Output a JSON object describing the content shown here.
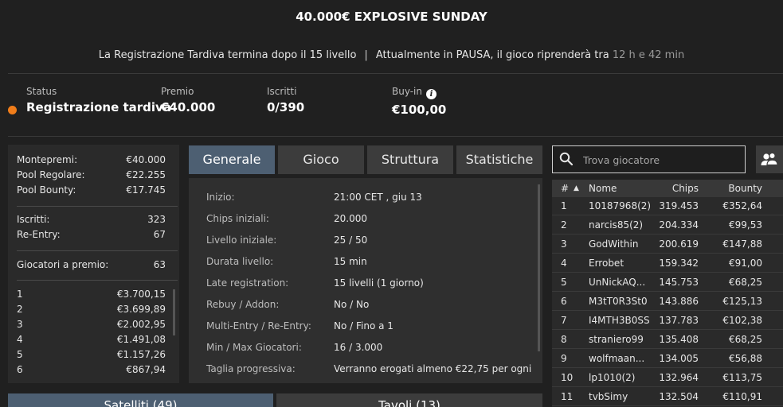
{
  "title": "40.000€ EXPLOSIVE SUNDAY",
  "late_reg": {
    "part1": "La Registrazione Tardiva termina dopo il 15 livello",
    "separator": "|",
    "part2": "Attualmente in PAUSA, il gioco riprenderà tra",
    "countdown": "12 h e 42 min"
  },
  "info": {
    "status_label": "Status",
    "status_value": "Registrazione tardiva",
    "status_color": "#f07d1a",
    "prize_label": "Premio",
    "prize_value": "€40.000",
    "entrants_label": "Iscritti",
    "entrants_value": "0/390",
    "buyin_label": "Buy-in",
    "buyin_value": "€100,00",
    "buyin_icon": "info-icon"
  },
  "prize_panel": {
    "rows_top": [
      {
        "label": "Montepremi:",
        "value": "€40.000"
      },
      {
        "label": "Pool Regolare:",
        "value": "€22.255"
      },
      {
        "label": "Pool Bounty:",
        "value": "€17.745"
      }
    ],
    "rows_mid": [
      {
        "label": "Iscritti:",
        "value": "323"
      },
      {
        "label": "Re-Entry:",
        "value": "67"
      }
    ],
    "paid": {
      "label": "Giocatori a premio:",
      "value": "63"
    },
    "places": [
      {
        "pos": "1",
        "amount": "€3.700,15"
      },
      {
        "pos": "2",
        "amount": "€3.699,89"
      },
      {
        "pos": "3",
        "amount": "€2.002,95"
      },
      {
        "pos": "4",
        "amount": "€1.491,08"
      },
      {
        "pos": "5",
        "amount": "€1.157,26"
      },
      {
        "pos": "6",
        "amount": "€867,94"
      }
    ]
  },
  "tabs": [
    "Generale",
    "Gioco",
    "Struttura",
    "Statistiche"
  ],
  "active_tab": "Generale",
  "details": [
    {
      "key": "Inizio:",
      "value": "21:00 CET , giu 13"
    },
    {
      "key": "Chips iniziali:",
      "value": "20.000"
    },
    {
      "key": "Livello iniziale:",
      "value": "25 / 50"
    },
    {
      "key": "Durata livello:",
      "value": "15 min"
    },
    {
      "key": "Late registration:",
      "value": "15 livelli (1 giorno)"
    },
    {
      "key": "Rebuy / Addon:",
      "value": "No / No"
    },
    {
      "key": "Multi-Entry / Re-Entry:",
      "value": "No / Fino a 1"
    },
    {
      "key": "Min / Max Giocatori:",
      "value": "16 / 3.000"
    },
    {
      "key": "Taglia progressiva:",
      "value": "Verranno erogati almeno €22,75 per ogni"
    }
  ],
  "search": {
    "placeholder": "Trova giocatore",
    "icon": "search-icon"
  },
  "people_icon": "users-icon",
  "players_table": {
    "headers": {
      "num": "#",
      "sort": "▲",
      "name": "Nome",
      "chips": "Chips",
      "bounty": "Bounty"
    },
    "rows": [
      {
        "num": "1",
        "name": "10187968(2)",
        "chips": "319.453",
        "bounty": "€352,64"
      },
      {
        "num": "2",
        "name": "narcis85(2)",
        "chips": "204.334",
        "bounty": "€99,53"
      },
      {
        "num": "3",
        "name": "GodWithin",
        "chips": "200.619",
        "bounty": "€147,88"
      },
      {
        "num": "4",
        "name": "Errobet",
        "chips": "159.342",
        "bounty": "€91,00"
      },
      {
        "num": "5",
        "name": "UnNickAQ...",
        "chips": "145.753",
        "bounty": "€68,25"
      },
      {
        "num": "6",
        "name": "M3tT0R3St0",
        "chips": "143.886",
        "bounty": "€125,13"
      },
      {
        "num": "7",
        "name": "I4MTH3B0SS",
        "chips": "137.783",
        "bounty": "€102,38"
      },
      {
        "num": "8",
        "name": "straniero99",
        "chips": "135.408",
        "bounty": "€68,25"
      },
      {
        "num": "9",
        "name": "wolfmaan...",
        "chips": "134.005",
        "bounty": "€56,88"
      },
      {
        "num": "10",
        "name": "lp1010(2)",
        "chips": "132.964",
        "bounty": "€113,75"
      },
      {
        "num": "11",
        "name": "tvbSimy",
        "chips": "132.504",
        "bounty": "€110,91"
      }
    ]
  },
  "bottom_buttons": {
    "satellites": "Satelliti (49)",
    "tables": "Tavoli (13)"
  }
}
